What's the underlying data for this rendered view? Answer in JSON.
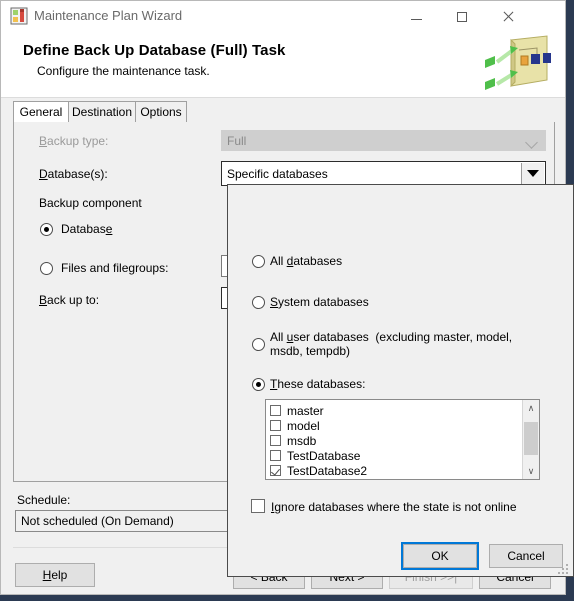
{
  "window": {
    "title": "Maintenance Plan Wizard",
    "icon": "maintenance-plan-icon",
    "minimize": "–",
    "maximize": "□",
    "close": "✕"
  },
  "header": {
    "title": "Define Back Up Database (Full) Task",
    "subtitle": "Configure the maintenance task."
  },
  "tabs": [
    {
      "label": "General",
      "active": true
    },
    {
      "label": "Destination",
      "active": false
    },
    {
      "label": "Options",
      "active": false
    }
  ],
  "general": {
    "backup_type_label": "Backup type:",
    "backup_type_value": "Full",
    "databases_label": "Database(s):",
    "databases_value": "Specific databases",
    "backup_component_label": "Backup component",
    "radio_database": "Database",
    "radio_files_filegroups": "Files and filegroups:",
    "back_up_to_label": "Back up to:"
  },
  "schedule": {
    "label": "Schedule:",
    "value": "Not scheduled (On Demand)"
  },
  "wizard_buttons": {
    "help": "Help",
    "back": "< Back",
    "next": "Next >",
    "finish": "Finish >>|",
    "cancel": "Cancel"
  },
  "popup": {
    "options": [
      {
        "label": "All databases",
        "selected": false
      },
      {
        "label": "System databases",
        "selected": false
      },
      {
        "label": "All user databases  (excluding master, model, msdb, tempdb)",
        "selected": false
      },
      {
        "label": "These databases:",
        "selected": true
      }
    ],
    "database_list": [
      {
        "name": "master",
        "checked": false
      },
      {
        "name": "model",
        "checked": false
      },
      {
        "name": "msdb",
        "checked": false
      },
      {
        "name": "TestDatabase",
        "checked": false
      },
      {
        "name": "TestDatabase2",
        "checked": true
      }
    ],
    "ignore_label": "Ignore databases where the state is not online",
    "ignore_checked": false,
    "ok": "OK",
    "cancel": "Cancel",
    "scroll_up_glyph": "∧",
    "scroll_down_glyph": "∨"
  },
  "colors": {
    "desktop": "#2b3a52",
    "dialog_face": "#f0f0f0",
    "focus_blue": "#0078d7",
    "title_text": "#6a6a6a"
  }
}
